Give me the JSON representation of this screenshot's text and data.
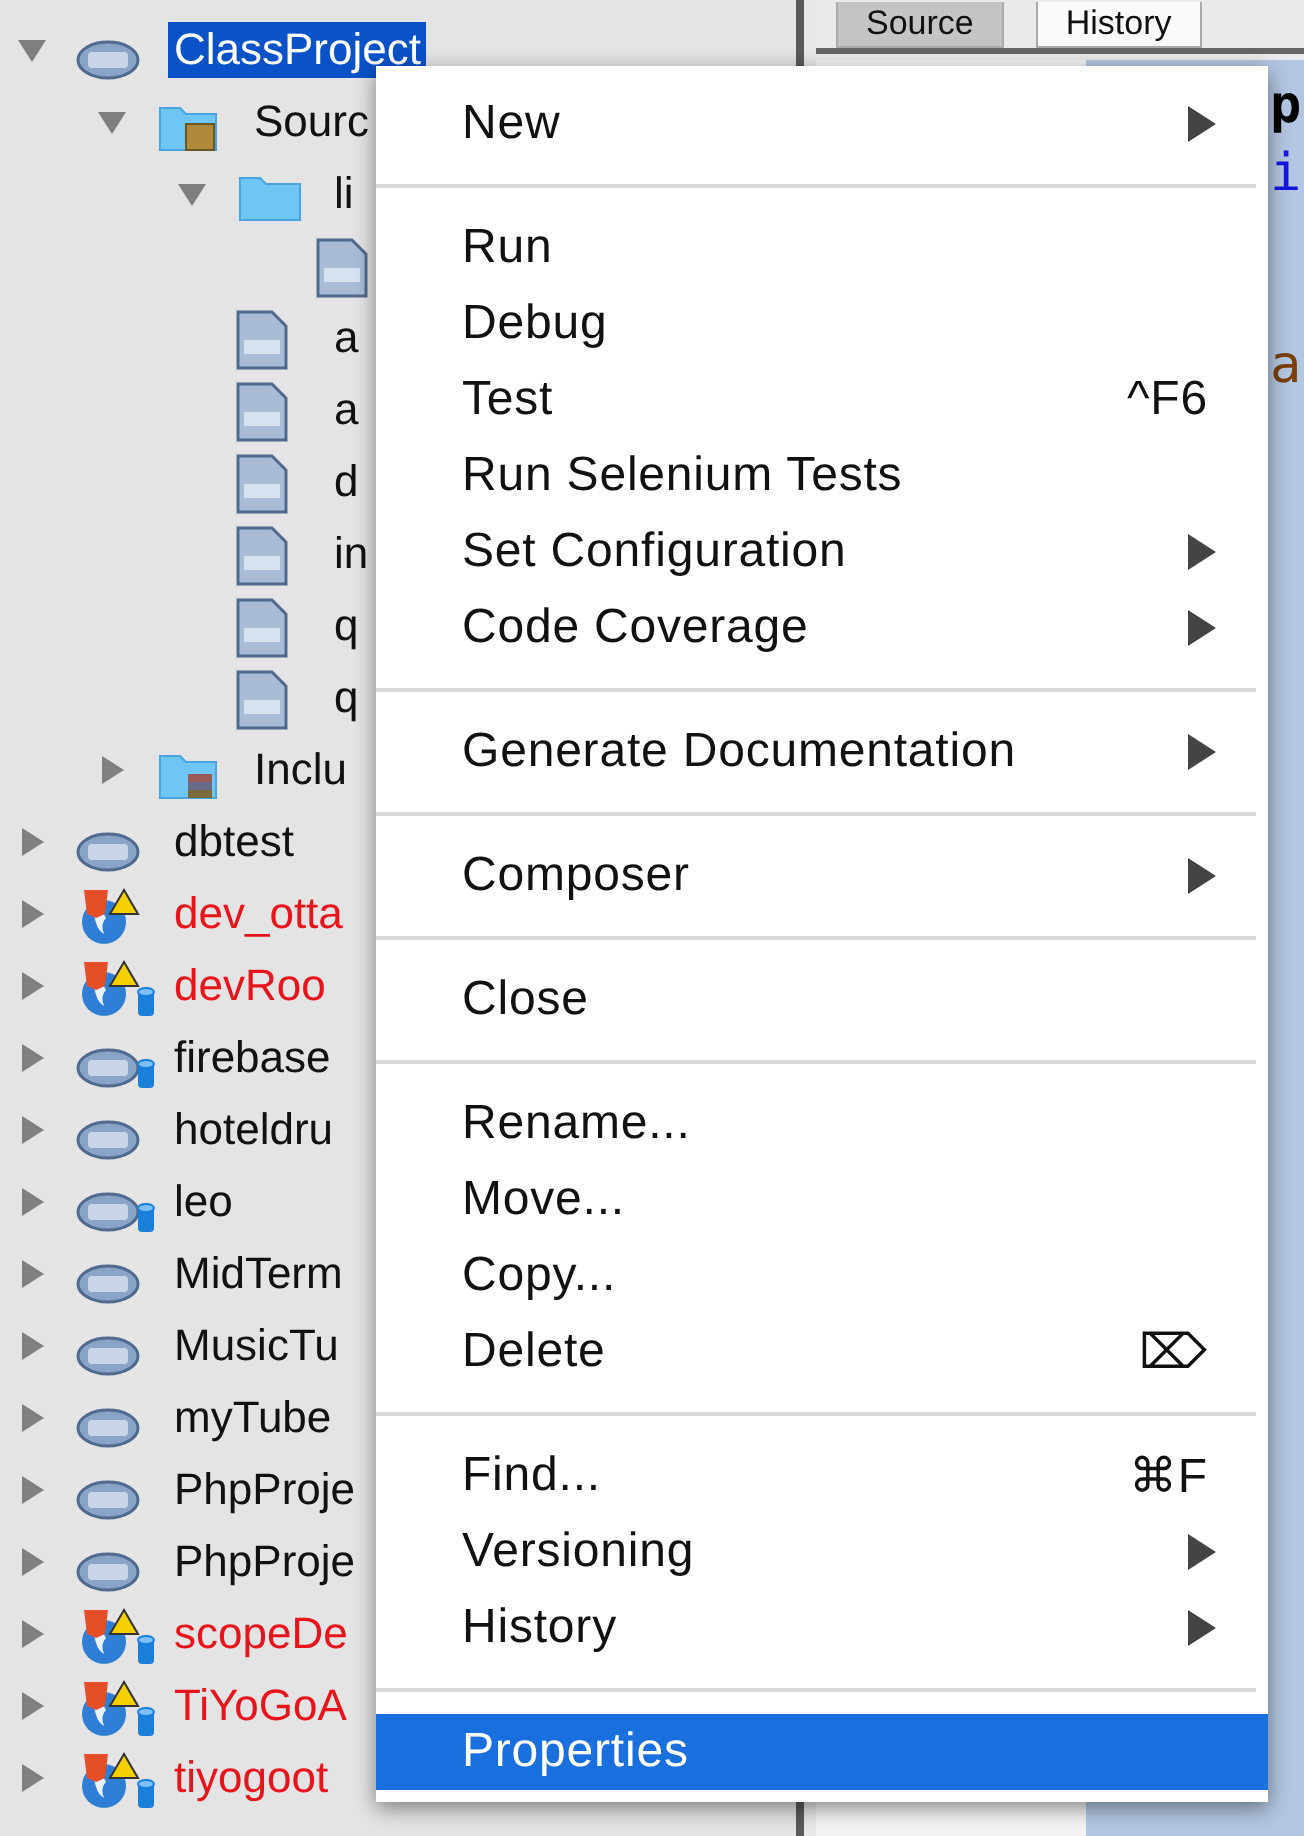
{
  "project_tree": [
    {
      "label": "ClassProject",
      "kind": "php",
      "expanded": true,
      "selected": true,
      "error": false,
      "database": false,
      "children": [
        {
          "label": "Sourc",
          "kind": "sources",
          "expanded": true,
          "selected": false,
          "children": [
            {
              "label": "li",
              "kind": "folder",
              "expanded": true,
              "selected": false,
              "children": [
                {
                  "kind": "file",
                  "selected": false
                }
              ]
            },
            {
              "label": "a",
              "kind": "file",
              "selected": false
            },
            {
              "label": "a",
              "kind": "file",
              "selected": false
            },
            {
              "label": "d",
              "kind": "file",
              "selected": false
            },
            {
              "label": "in",
              "kind": "file",
              "selected": false
            },
            {
              "label": "q",
              "kind": "file",
              "selected": false
            },
            {
              "label": "q",
              "kind": "file",
              "selected": false
            }
          ]
        },
        {
          "label": "Inclu",
          "kind": "library",
          "expanded": false,
          "selected": false
        }
      ]
    },
    {
      "label": "dbtest",
      "kind": "php",
      "expanded": false,
      "selected": false,
      "error": false,
      "database": false
    },
    {
      "label": "dev_otta",
      "kind": "html5",
      "expanded": false,
      "selected": false,
      "error": true,
      "database": false
    },
    {
      "label": "devRoo",
      "kind": "html5",
      "expanded": false,
      "selected": false,
      "error": true,
      "database": true
    },
    {
      "label": "firebase",
      "kind": "php",
      "expanded": false,
      "selected": false,
      "error": false,
      "database": true
    },
    {
      "label": "hoteldru",
      "kind": "php",
      "expanded": false,
      "selected": false,
      "error": false,
      "database": false
    },
    {
      "label": "leo",
      "kind": "php",
      "expanded": false,
      "selected": false,
      "error": false,
      "database": true
    },
    {
      "label": "MidTerm",
      "kind": "php",
      "expanded": false,
      "selected": false,
      "error": false,
      "database": false
    },
    {
      "label": "MusicTu",
      "kind": "php",
      "expanded": false,
      "selected": false,
      "error": false,
      "database": false
    },
    {
      "label": "myTube",
      "kind": "php",
      "expanded": false,
      "selected": false,
      "error": false,
      "database": false
    },
    {
      "label": "PhpProje",
      "kind": "php",
      "expanded": false,
      "selected": false,
      "error": false,
      "database": false
    },
    {
      "label": "PhpProje",
      "kind": "php",
      "expanded": false,
      "selected": false,
      "error": false,
      "database": false
    },
    {
      "label": "scopeDe",
      "kind": "html5",
      "expanded": false,
      "selected": false,
      "error": true,
      "database": true
    },
    {
      "label": "TiYoGoA",
      "kind": "html5",
      "expanded": false,
      "selected": false,
      "error": true,
      "database": true
    },
    {
      "label": "tiyogoot",
      "kind": "html5",
      "expanded": false,
      "selected": false,
      "error": true,
      "database": true
    }
  ],
  "editor": {
    "tabs": [
      {
        "label": "Source",
        "selected": true
      },
      {
        "label": "History",
        "selected": false
      }
    ],
    "code_lines": [
      {
        "text": "p",
        "kind": "keyword"
      },
      {
        "text": "i",
        "kind": "link"
      },
      {
        "text": "a",
        "kind": "string"
      }
    ]
  },
  "context_menu": [
    {
      "kind": "item",
      "label": "New",
      "submenu": true,
      "selected": false
    },
    {
      "kind": "separator"
    },
    {
      "kind": "item",
      "label": "Run",
      "submenu": false,
      "selected": false
    },
    {
      "kind": "item",
      "label": "Debug",
      "submenu": false,
      "selected": false
    },
    {
      "kind": "item",
      "label": "Test",
      "shortcut": "^F6",
      "submenu": false,
      "selected": false
    },
    {
      "kind": "item",
      "label": "Run Selenium Tests",
      "submenu": false,
      "selected": false
    },
    {
      "kind": "item",
      "label": "Set Configuration",
      "submenu": true,
      "selected": false
    },
    {
      "kind": "item",
      "label": "Code Coverage",
      "submenu": true,
      "selected": false
    },
    {
      "kind": "separator"
    },
    {
      "kind": "item",
      "label": "Generate Documentation",
      "submenu": true,
      "selected": false
    },
    {
      "kind": "separator"
    },
    {
      "kind": "item",
      "label": "Composer",
      "submenu": true,
      "selected": false
    },
    {
      "kind": "separator"
    },
    {
      "kind": "item",
      "label": "Close",
      "submenu": false,
      "selected": false
    },
    {
      "kind": "separator"
    },
    {
      "kind": "item",
      "label": "Rename...",
      "submenu": false,
      "selected": false
    },
    {
      "kind": "item",
      "label": "Move...",
      "submenu": false,
      "selected": false
    },
    {
      "kind": "item",
      "label": "Copy...",
      "submenu": false,
      "selected": false
    },
    {
      "kind": "item",
      "label": "Delete",
      "shortcut": "⌦",
      "submenu": false,
      "selected": false
    },
    {
      "kind": "separator"
    },
    {
      "kind": "item",
      "label": "Find...",
      "shortcut": "⌘F",
      "submenu": false,
      "selected": false
    },
    {
      "kind": "item",
      "label": "Versioning",
      "submenu": true,
      "selected": false
    },
    {
      "kind": "item",
      "label": "History",
      "submenu": true,
      "selected": false
    },
    {
      "kind": "separator"
    },
    {
      "kind": "item",
      "label": "Properties",
      "submenu": false,
      "selected": true
    }
  ]
}
